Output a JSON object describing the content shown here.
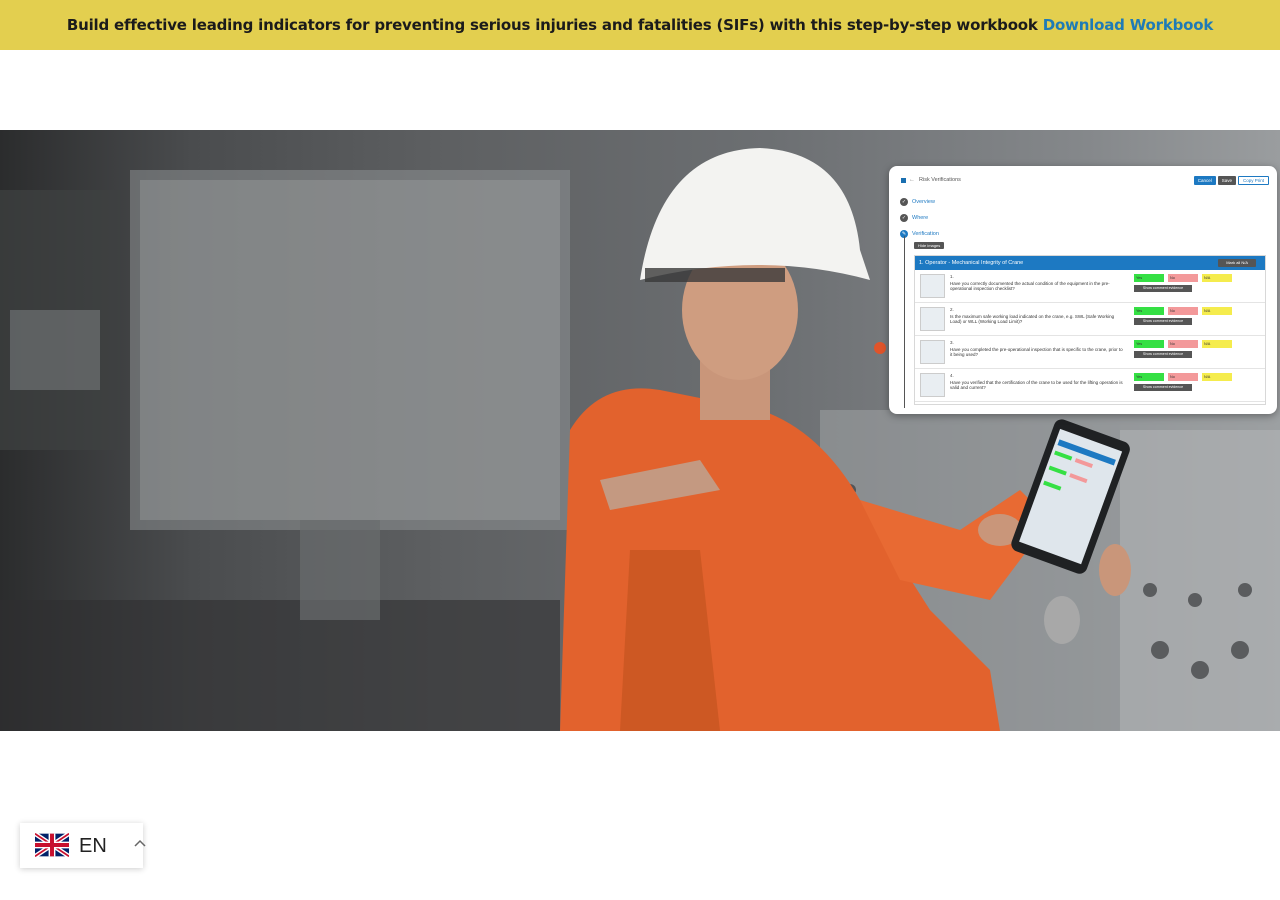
{
  "banner": {
    "text": "Build effective leading indicators for preventing serious injuries and fatalities (SIFs) with this step-by-step workbook",
    "link_label": "Download Workbook",
    "background": "#e3cf4f",
    "link_color": "#1f7bb6"
  },
  "hero": {
    "image_alt": "Worker in orange coveralls and white hard hat using a tablet in a control room",
    "panel": {
      "title": "Risk Verifications",
      "actions": [
        "Cancel",
        "Save",
        "Copy Print"
      ],
      "steps": [
        "Overview",
        "Where",
        "Verification"
      ],
      "hide_images_label": "Hide images",
      "section_title": "1. Operator - Mechanical Integrity of Crane",
      "section_action": "Mark all N/A",
      "option_labels": [
        "Yes",
        "No",
        "N/A"
      ],
      "evidence_label": "Show comment evidence",
      "questions": [
        {
          "num": "1.",
          "text": "Have you correctly documented the actual condition of the equipment in the pre-operational inspection checklist?"
        },
        {
          "num": "2.",
          "text": "Is the maximum safe working load indicated on the crane, e.g. SWL (Safe Working Load) or WLL (Working Load Limit)?"
        },
        {
          "num": "3.",
          "text": "Have you completed the pre-operational inspection that is specific to the crane, prior to it being used?"
        },
        {
          "num": "4.",
          "text": "Have you verified that the certification of the crane to be used for the lifting operation is valid and current?"
        }
      ]
    }
  },
  "language": {
    "code": "EN",
    "flag": "uk-flag-icon"
  }
}
